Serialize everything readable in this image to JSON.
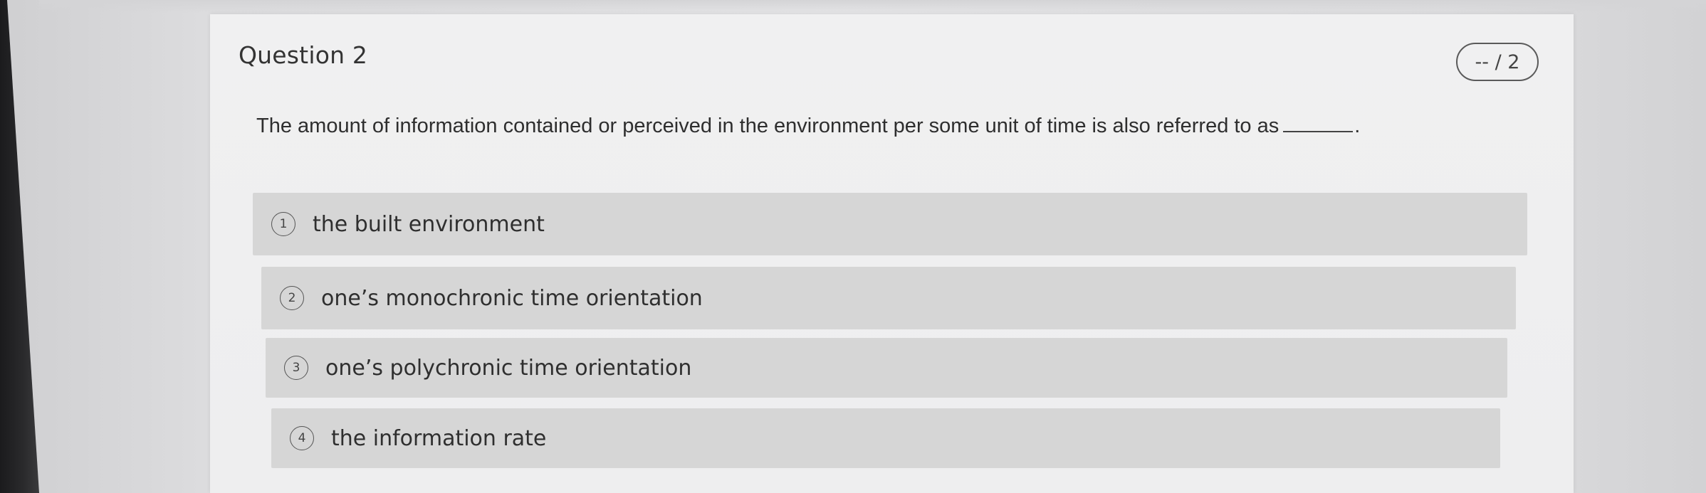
{
  "question": {
    "title": "Question 2",
    "score": "-- / 2",
    "prompt": "The amount of information contained or perceived in the environment per some unit of time is also referred to as",
    "prompt_end": "."
  },
  "options": [
    {
      "number": "1",
      "label": "the built environment"
    },
    {
      "number": "2",
      "label": "one’s monochronic time orientation"
    },
    {
      "number": "3",
      "label": "one’s polychronic time orientation"
    },
    {
      "number": "4",
      "label": "the information rate"
    }
  ]
}
